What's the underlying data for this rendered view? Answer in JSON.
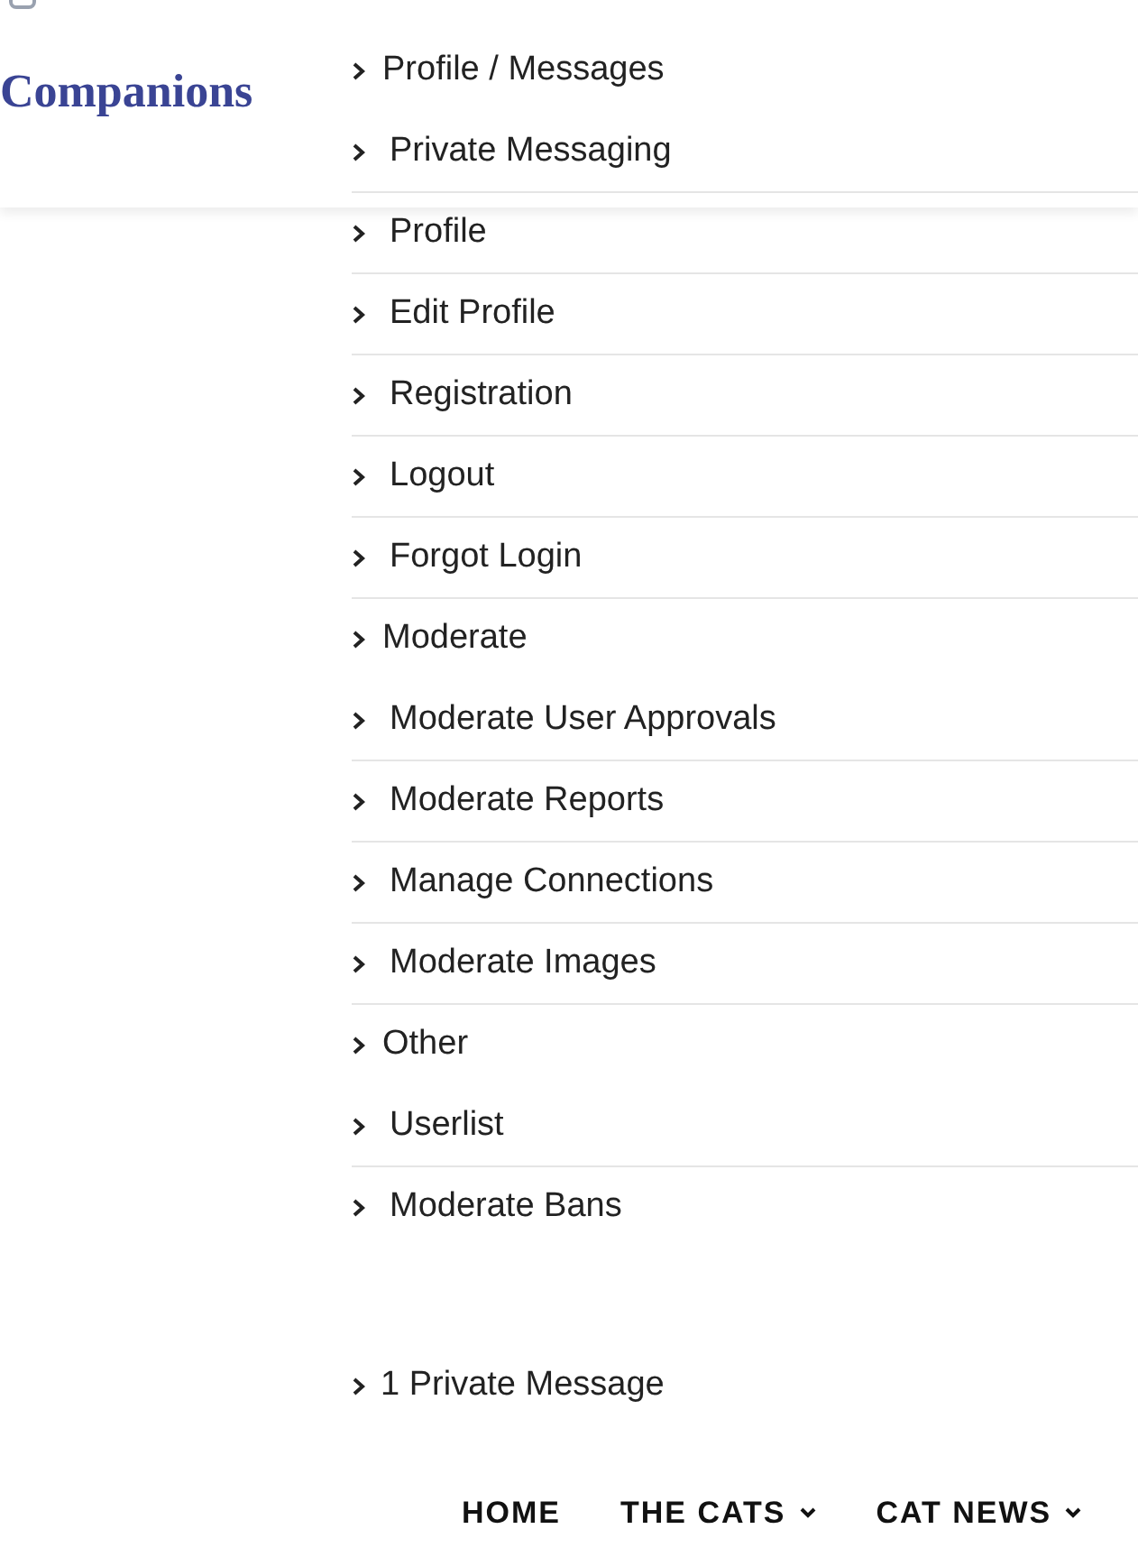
{
  "header": {
    "logo": "Companions"
  },
  "menu": [
    {
      "kind": "heading",
      "label": "Profile / Messages"
    },
    {
      "kind": "item",
      "label": "Private Messaging"
    },
    {
      "kind": "item",
      "label": "Profile"
    },
    {
      "kind": "item",
      "label": "Edit Profile"
    },
    {
      "kind": "item",
      "label": "Registration"
    },
    {
      "kind": "item",
      "label": "Logout"
    },
    {
      "kind": "item",
      "label": "Forgot Login"
    },
    {
      "kind": "heading",
      "label": "Moderate"
    },
    {
      "kind": "item",
      "label": "Moderate User Approvals"
    },
    {
      "kind": "item",
      "label": "Moderate Reports"
    },
    {
      "kind": "item",
      "label": "Manage Connections"
    },
    {
      "kind": "item",
      "label": "Moderate Images"
    },
    {
      "kind": "heading",
      "label": "Other"
    },
    {
      "kind": "item",
      "label": "Userlist"
    },
    {
      "kind": "item",
      "label": "Moderate Bans"
    }
  ],
  "messages_link": "1 Private Message",
  "nav": [
    {
      "label": "HOME",
      "dropdown": false
    },
    {
      "label": "THE CATS",
      "dropdown": true
    },
    {
      "label": "CAT NEWS",
      "dropdown": true
    }
  ]
}
